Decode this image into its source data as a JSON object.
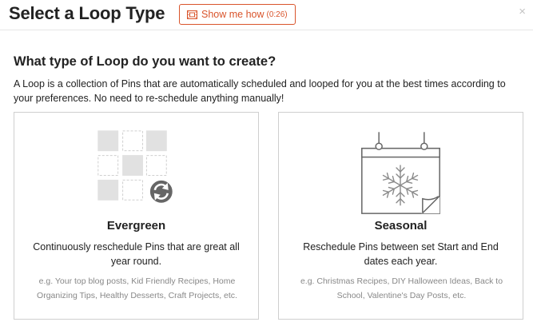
{
  "header": {
    "title": "Select a Loop Type",
    "video_button": {
      "label": "Show me how",
      "duration": "(0:26)",
      "icon": "film-icon"
    },
    "close": "×"
  },
  "main": {
    "question": "What type of Loop do you want to create?",
    "intro": "A Loop is a collection of Pins that are automatically scheduled and looped for you at the best times according to your preferences. No need to re-schedule anything manually!"
  },
  "cards": [
    {
      "title": "Evergreen",
      "description": "Continuously reschedule Pins that are great all year round.",
      "examples": "e.g. Your top blog posts, Kid Friendly Recipes, Home Organizing Tips, Healthy Desserts, Craft Projects, etc.",
      "icon": "repeat-grid-icon"
    },
    {
      "title": "Seasonal",
      "description": "Reschedule Pins between set Start and End dates each year.",
      "examples": "e.g. Christmas Recipes, DIY Halloween Ideas, Back to School, Valentine's Day Posts, etc.",
      "icon": "calendar-snowflake-icon"
    }
  ],
  "colors": {
    "accent": "#d9542b",
    "icon_gray": "#666666",
    "tile_fill": "#e1e1e1",
    "muted_text": "#888888"
  }
}
